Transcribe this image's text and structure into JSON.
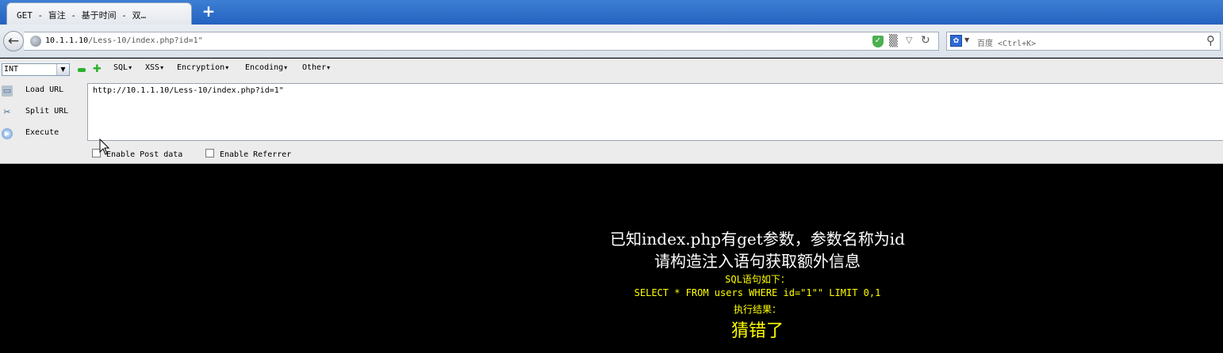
{
  "browser": {
    "tab_title": "GET - 盲注 - 基于时间 - 双…",
    "new_tab_symbol": "+",
    "url_host": "10.1.1.10",
    "url_path": "/Less-10/index.php?id=1\"",
    "search_engine": "百度",
    "search_placeholder": "<Ctrl+K>"
  },
  "hackbar": {
    "type_select_value": "INT",
    "menus": [
      "SQL",
      "XSS",
      "Encryption",
      "Encoding",
      "Other"
    ],
    "buttons": {
      "load_url": "Load URL",
      "split_url": "Split URL",
      "execute": "Execute"
    },
    "url_value": "http://10.1.1.10/Less-10/index.php?id=1\"",
    "enable_post_data": "Enable Post data",
    "enable_referrer": "Enable Referrer",
    "enable_post_checked": false,
    "enable_referrer_checked": false
  },
  "page": {
    "line_known": "已知index.php有get参数，参数名称为id",
    "line_construct": "请构造注入语句获取额外信息",
    "sql_label": "SQL语句如下：",
    "sql_statement": "SELECT * FROM users WHERE id=\"1\"\" LIMIT 0,1",
    "result_label": "执行结果：",
    "result_value": "猜错了"
  },
  "colors": {
    "tabbar": "#2d6ccb",
    "page_background": "#000000",
    "page_text_white": "#ffffff",
    "page_text_yellow": "#ffff00",
    "hackbar_background": "#ececec"
  },
  "icons": [
    "back-arrow-icon",
    "globe-icon",
    "shield-icon",
    "qr-code-icon",
    "dropdown-icon",
    "reload-icon",
    "baidu-paw-icon",
    "search-icon",
    "minus-icon",
    "plus-icon",
    "load-url-icon",
    "split-url-icon",
    "execute-icon",
    "mouse-cursor-icon"
  ]
}
